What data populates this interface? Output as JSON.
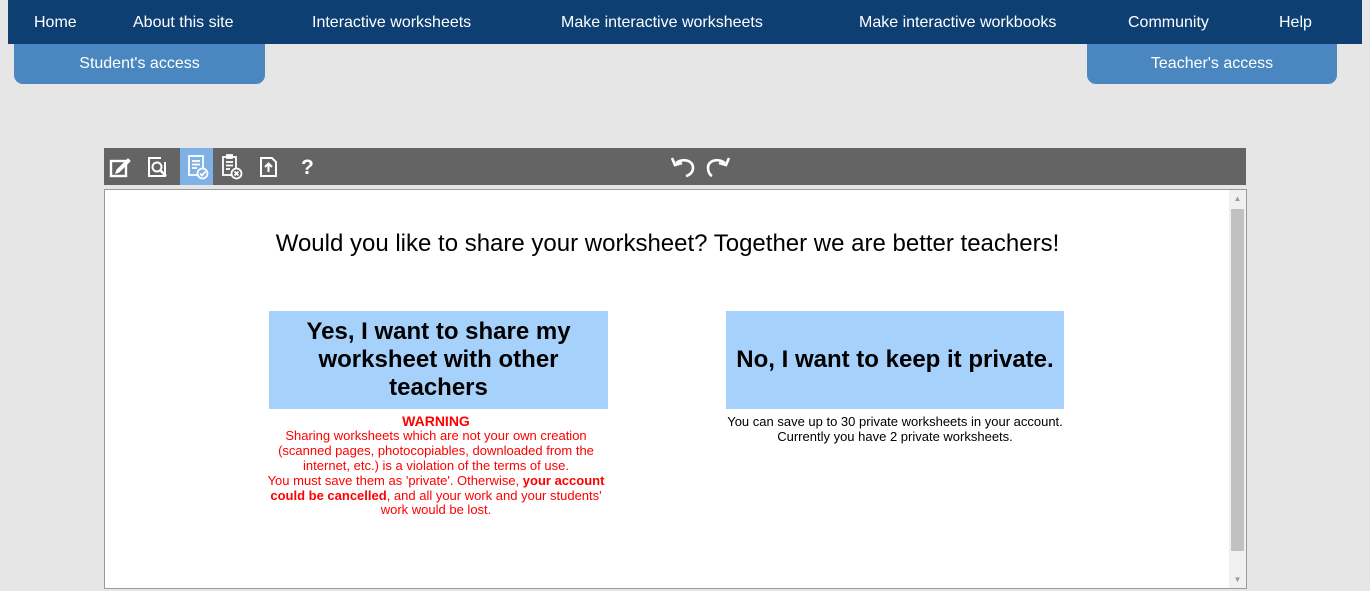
{
  "nav": {
    "home": "Home",
    "about": "About this site",
    "interactive_worksheets": "Interactive worksheets",
    "make_worksheets": "Make interactive worksheets",
    "make_workbooks": "Make interactive workbooks",
    "community": "Community",
    "help": "Help"
  },
  "access": {
    "student": "Student's access",
    "teacher": "Teacher's access"
  },
  "toolbar": {
    "help_label": "?",
    "icons": [
      "edit-icon",
      "preview-icon",
      "finish-icon",
      "delete-answers-icon",
      "upload-icon",
      "help-icon",
      "undo-icon",
      "redo-icon"
    ],
    "active_color": "#7fb0e6"
  },
  "main": {
    "question": "Would you like to share your worksheet? Together we are better teachers!",
    "share_button": "Yes, I want to share my worksheet with other teachers",
    "warning_title": "WARNING",
    "warning_text_1": "Sharing worksheets which are not your own creation (scanned pages, photocopiables, downloaded from the internet, etc.) is a violation of the terms of use.",
    "warning_text_2a": "You must save them as 'private'. Otherwise, ",
    "warning_text_2b": "your account could be cancelled",
    "warning_text_2c": ", and all your work and your students' work would be lost.",
    "private_button": "No, I want to keep it private.",
    "private_info_1": "You can save up to 30 private worksheets in your account.",
    "private_info_2": "Currently you have 2 private worksheets."
  },
  "colors": {
    "nav_bg": "#0d3f73",
    "access_tab": "#4a87c1",
    "button_bg": "#a6d1fb",
    "warning": "#ff0000",
    "toolbar_bg": "#646464"
  }
}
